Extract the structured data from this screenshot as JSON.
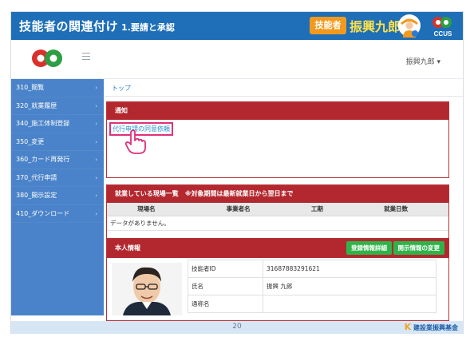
{
  "title": {
    "main": "技能者の関連付け",
    "sub": "1.要請と承認",
    "badge": "技能者",
    "user_big": "振興九郎"
  },
  "logos": {
    "ccus": "CCUS"
  },
  "header": {
    "user_menu": "振興九郎 ▾"
  },
  "sidebar": {
    "items": [
      {
        "label": "310_閲覧"
      },
      {
        "label": "320_就業履歴"
      },
      {
        "label": "340_施工体制登録"
      },
      {
        "label": "350_変更"
      },
      {
        "label": "360_カード再発行"
      },
      {
        "label": "370_代行申請"
      },
      {
        "label": "380_開示設定"
      },
      {
        "label": "410_ダウンロード"
      }
    ]
  },
  "breadcrumb": "トップ",
  "notice": {
    "heading": "通知",
    "link": "代行申請の同意依頼"
  },
  "work": {
    "heading": "就業している現場一覧　※対象期間は最新就業日から翌日まで",
    "columns": [
      "現場名",
      "事業者名",
      "工期",
      "就業日数"
    ],
    "empty": "データがありません。"
  },
  "personal": {
    "heading": "本人情報",
    "btn_detail": "登録情報詳細",
    "btn_disclosure": "開示情報の変更",
    "rows": [
      {
        "label": "技能者ID",
        "value": "31687883291621"
      },
      {
        "label": "氏名",
        "value": "振興 九郎"
      },
      {
        "label": "通称名",
        "value": ""
      }
    ]
  },
  "footer": {
    "page": "20",
    "org": "建設業振興基金"
  },
  "colors": {
    "title_bg": "#1e6fb8",
    "sidebar_bg": "#4a83c9",
    "panel_red": "#b3282f",
    "accent_orange": "#f39a1e",
    "button_green": "#2fb34a",
    "link_blue": "#2a8fd0"
  }
}
